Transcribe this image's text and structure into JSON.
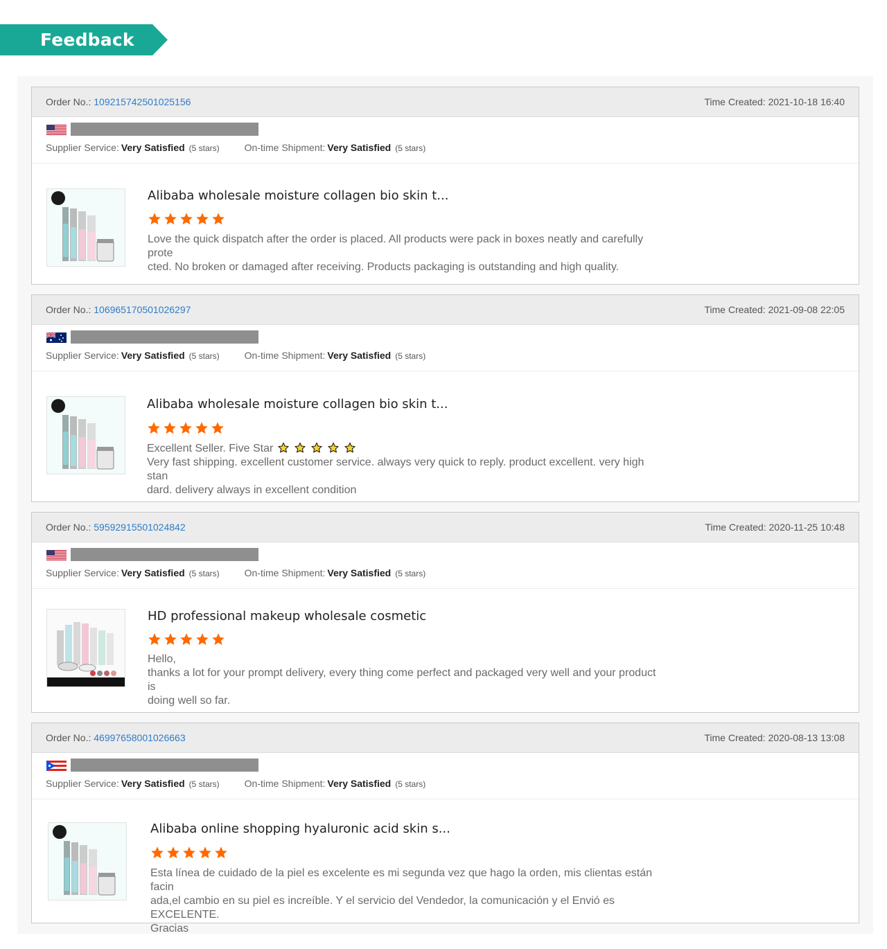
{
  "banner": {
    "label": "Feedback",
    "color": "#1aa896"
  },
  "labels": {
    "order_no": "Order No.:",
    "time_created": "Time Created:",
    "supplier_service": "Supplier Service:",
    "ontime_shipment": "On-time Shipment:"
  },
  "colors": {
    "order_link": "#2f7cc8",
    "star": "#ff6a00",
    "redaction": "#8f8f8f"
  },
  "reviews": [
    {
      "order_no": "109215742501025156",
      "time_created": "2021-10-18 16:40",
      "flag": "us-flag",
      "supplier_rating": "Very Satisfied",
      "supplier_stars": "(5 stars)",
      "shipment_rating": "Very Satisfied",
      "shipment_stars": "(5 stars)",
      "product_title": "Alibaba wholesale moisture collagen bio skin t...",
      "rating": 5,
      "comment": [
        "Love the quick dispatch after the order is placed. All products were pack in boxes neatly and carefully prote",
        "cted. No broken or damaged after receiving. Products packaging is outstanding and high quality."
      ]
    },
    {
      "order_no": "106965170501026297",
      "time_created": "2021-09-08 22:05",
      "flag": "au-flag",
      "supplier_rating": "Very Satisfied",
      "supplier_stars": "(5 stars)",
      "shipment_rating": "Very Satisfied",
      "shipment_stars": "(5 stars)",
      "product_title": "Alibaba wholesale moisture collagen bio skin t...",
      "rating": 5,
      "comment_lead": "Excellent Seller. Five Star",
      "comment": [
        "Very fast shipping. excellent customer service. always very quick to reply. product excellent. very high stan",
        "dard. delivery always in excellent condition"
      ]
    },
    {
      "order_no": "59592915501024842",
      "time_created": "2020-11-25 10:48",
      "flag": "us-flag",
      "supplier_rating": "Very Satisfied",
      "supplier_stars": "(5 stars)",
      "shipment_rating": "Very Satisfied",
      "shipment_stars": "(5 stars)",
      "product_title": "HD professional makeup wholesale cosmetic",
      "rating": 5,
      "comment": [
        "Hello,",
        "thanks a lot for your prompt delivery, every thing come perfect and packaged very well and your product is",
        "doing well so far."
      ]
    },
    {
      "order_no": "46997658001026663",
      "time_created": "2020-08-13 13:08",
      "flag": "pr-flag",
      "supplier_rating": "Very Satisfied",
      "supplier_stars": "(5 stars)",
      "shipment_rating": "Very Satisfied",
      "shipment_stars": "(5 stars)",
      "product_title": "Alibaba online shopping hyaluronic acid skin s...",
      "rating": 5,
      "comment": [
        "Esta línea de cuidado de la piel es excelente es mi segunda vez que hago la orden, mis clientas están facin",
        "ada,el cambio en su piel es increíble. Y el servicio del Vendedor, la comunicación y el Envió es EXCELENTE.",
        "Gracias"
      ]
    }
  ]
}
